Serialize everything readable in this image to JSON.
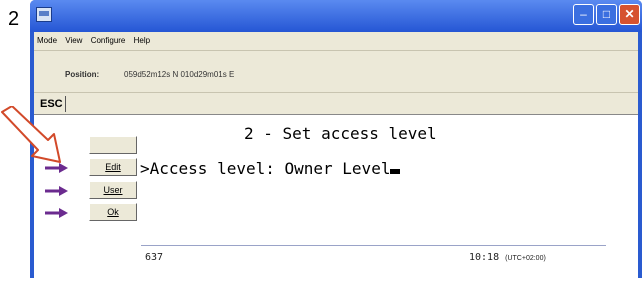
{
  "step_number": "2",
  "window": {
    "min_glyph": "–",
    "max_glyph": "□",
    "close_glyph": "✕"
  },
  "menu": [
    "Mode",
    "View",
    "Configure",
    "Help"
  ],
  "position": {
    "label": "Position:",
    "value": "059d52m12s N 010d29m01s E"
  },
  "esc_label": "ESC",
  "side_buttons": {
    "blank": "",
    "edit": "Edit",
    "user": "User",
    "ok": "Ok"
  },
  "screen": {
    "title": "2 - Set access level",
    "line": ">Access level: Owner Level"
  },
  "status": {
    "left": "637",
    "time": "10:18",
    "timezone": "(UTC+02:00)"
  },
  "colors": {
    "arrow": "#6b2b8f",
    "callout": "#d24a2a",
    "title_bar": "#2556d4"
  }
}
